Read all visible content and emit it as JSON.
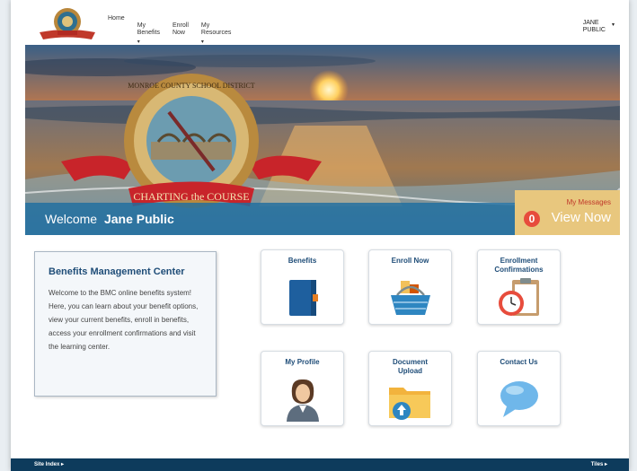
{
  "nav": {
    "items": [
      {
        "label": "Home",
        "caret": ""
      },
      {
        "label": "My\nBenefits",
        "caret": "▾"
      },
      {
        "label": "Enroll\nNow",
        "caret": ""
      },
      {
        "label": "My\nResources",
        "caret": "▾"
      }
    ],
    "user_first": "JANE",
    "user_last": "PUBLIC",
    "user_caret": "▾"
  },
  "logo": {
    "seal_top": "MONROE COUNTY SCHOOL DISTRICT",
    "banner": "CHARTING the COURSE"
  },
  "welcome": {
    "prefix": "Welcome",
    "name": "Jane Public"
  },
  "messages": {
    "label": "My Messages",
    "count": "0",
    "action": "View Now"
  },
  "info": {
    "title": "Benefits Management Center",
    "body": "Welcome to the BMC online benefits system! Here, you can learn about your benefit options, view your current benefits, enroll in benefits, access your enrollment confirmations and visit the learning center."
  },
  "tiles": {
    "benefits": "Benefits",
    "enroll": "Enroll Now",
    "confirmations": "Enrollment Confirmations",
    "profile": "My Profile",
    "upload": "Document Upload",
    "contact": "Contact Us"
  },
  "footer": {
    "left": "Site Index ▸",
    "right": "Tiles ▸"
  },
  "colors": {
    "accent": "#1f4d78",
    "welcome_bar": "#1e6ea0",
    "messages_bg": "#e8c77e",
    "footer": "#0d3b5c"
  }
}
